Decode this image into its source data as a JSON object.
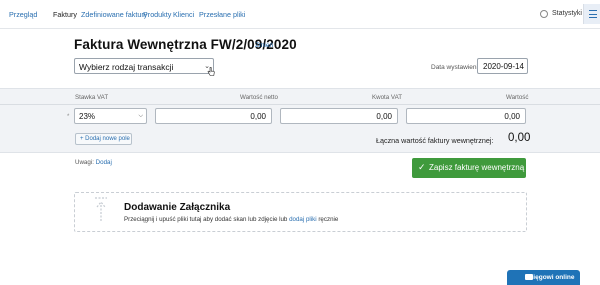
{
  "nav": {
    "items": [
      "Przegląd",
      "Faktury",
      "Zdefiniowane faktury",
      "Produkty",
      "Klienci",
      "Przesłane pliki"
    ],
    "active_index": 1,
    "stats_label": "Statystyki"
  },
  "invoice": {
    "title": "Faktura Wewnętrzna FW/2/09/2020",
    "change_link": "Zmień",
    "transaction_select": "Wybierz rodzaj transakcji",
    "date_label": "Data wystawienia",
    "date_value": "2020-09-14"
  },
  "table": {
    "headers": [
      "Stawka VAT",
      "Wartość netto",
      "Kwota VAT",
      "Wartość"
    ],
    "row": {
      "vat_rate": "23%",
      "net_value": "0,00",
      "vat_amount": "0,00",
      "gross_value": "0,00"
    },
    "add_button": "Dodaj nowe pole"
  },
  "summary": {
    "total_label": "Łączna wartość faktury wewnętrznej:",
    "total_value": "0,00"
  },
  "notes": {
    "label": "Uwagi:",
    "link": "Dodaj"
  },
  "save_button": "Zapisz fakturę wewnętrzną",
  "attachment": {
    "title": "Dodawanie Załącznika",
    "text_before": "Przeciągnij i upuść pliki tutaj aby dodać skan lub zdjęcie lub",
    "link": "dodaj pliki",
    "text_after": "ręcznie"
  },
  "chat": {
    "label": "Księgowi online"
  },
  "colors": {
    "link": "#2a6fb0",
    "save": "#3f9a3c",
    "chat": "#1f73b7"
  }
}
